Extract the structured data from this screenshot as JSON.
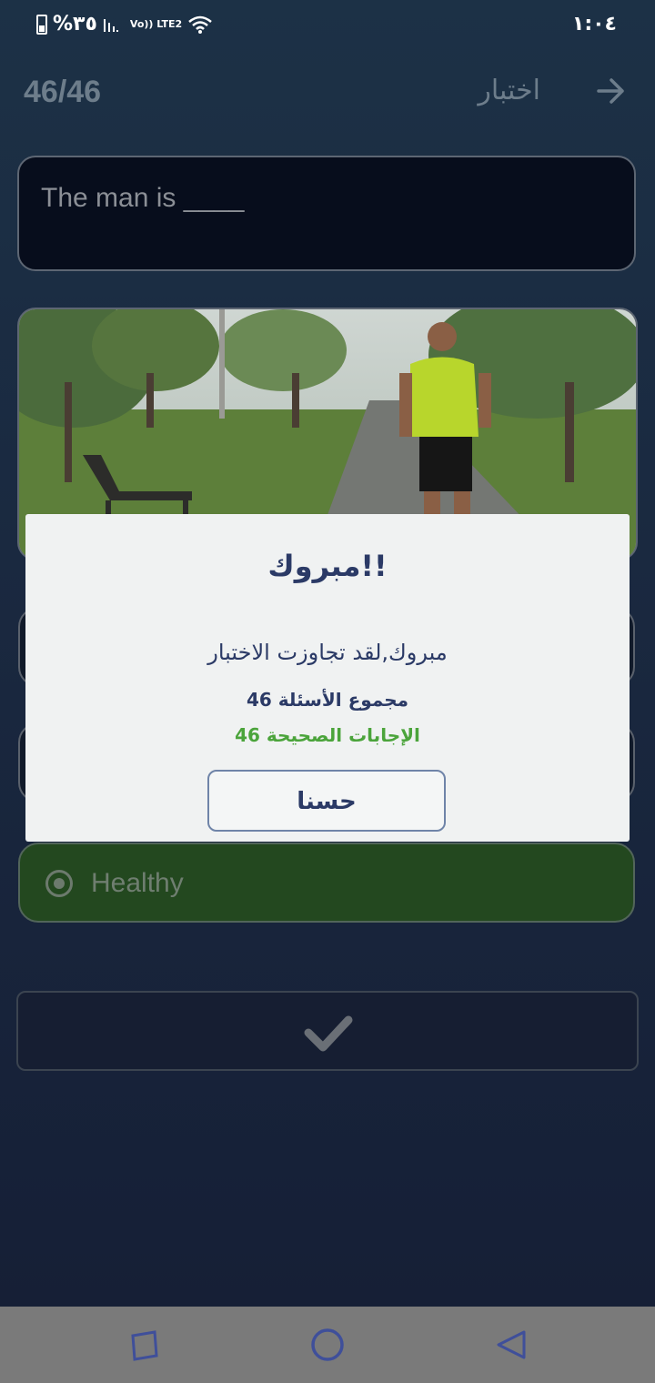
{
  "status_bar": {
    "battery_text": "%٣٥",
    "network_label": "Vo)) LTE2",
    "time": "١:٠٤"
  },
  "app_bar": {
    "counter": "46/46",
    "title": "اختبار",
    "back_icon": "arrow-right-icon"
  },
  "question": {
    "text": "The man is ____"
  },
  "image": {
    "description_icon": "photo-runner"
  },
  "options": [
    {
      "label": "",
      "selected": false
    },
    {
      "label": "",
      "selected": false
    },
    {
      "label": "Healthy",
      "selected": true
    }
  ],
  "submit": {
    "icon": "check-icon"
  },
  "dialog": {
    "title": "مبروك!!",
    "message": "مبروك,لقد تجاوزت الاختبار",
    "total_questions": "مجموع الأسئلة 46",
    "correct_answers": "الإجابات الصحيحة 46",
    "ok_button": "حسنا"
  },
  "nav_bar": {
    "recents_icon": "square-icon",
    "home_icon": "circle-icon",
    "back_icon": "triangle-back-icon"
  },
  "colors": {
    "background": "#1a2940",
    "dialog_bg": "#f0f2f2",
    "dialog_text": "#2b3a66",
    "correct_green": "#4ba43b",
    "selected_option": "#23481f"
  }
}
